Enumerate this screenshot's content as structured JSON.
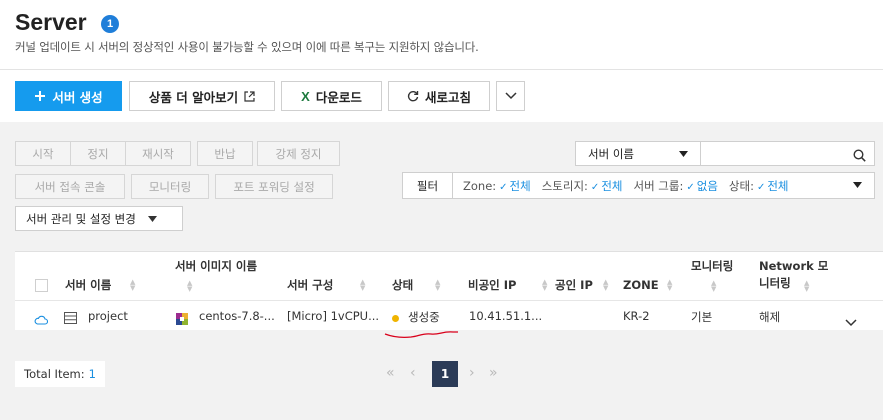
{
  "header": {
    "title": "Server",
    "badge": "1",
    "subtitle": "커널 업데이트 시 서버의 정상적인 사용이 불가능할 수 있으며 이에 따른 복구는 지원하지 않습니다."
  },
  "toolbar": {
    "create_label": "서버 생성",
    "learn_more_label": "상품 더 알아보기",
    "download_label": "다운로드",
    "refresh_label": "새로고침"
  },
  "actions": {
    "start": "시작",
    "stop": "정지",
    "restart": "재시작",
    "return": "반납",
    "force_stop": "강제 정지",
    "console": "서버 접속 콘솔",
    "monitoring": "모니터링",
    "port_forwarding": "포트 포워딩 설정",
    "manage": "서버 관리 및 설정 변경"
  },
  "search": {
    "field": "서버 이름",
    "value": ""
  },
  "filter": {
    "label": "필터",
    "items": [
      {
        "name": "Zone:",
        "value": "전체"
      },
      {
        "name": "스토리지:",
        "value": "전체"
      },
      {
        "name": "서버 그룹:",
        "value": "없음"
      },
      {
        "name": "상태:",
        "value": "전체"
      }
    ]
  },
  "table": {
    "columns": {
      "name": "서버 이름",
      "image_line1": "서버 이미지 이름",
      "spec": "서버 구성",
      "status": "상태",
      "private_ip": "비공인 IP",
      "public_ip": "공인 IP",
      "zone": "ZONE",
      "monitoring": "모니터링",
      "network_line1": "Network 모",
      "network_line2": "니터링"
    },
    "rows": [
      {
        "name": "project",
        "image": "centos-7.8-...",
        "spec": "[Micro] 1vCPU...",
        "status": "생성중",
        "private_ip": "10.41.51.1...",
        "public_ip": "",
        "zone": "KR-2",
        "monitoring": "기본",
        "network": "해제"
      }
    ]
  },
  "pagination": {
    "total_label": "Total Item:",
    "total": "1",
    "current": "1"
  },
  "colors": {
    "primary": "#159bee",
    "accent_text": "#1a8fe0",
    "status_pending": "#f0b400",
    "annotation": "#d9001b",
    "page_active": "#2b3b57"
  }
}
